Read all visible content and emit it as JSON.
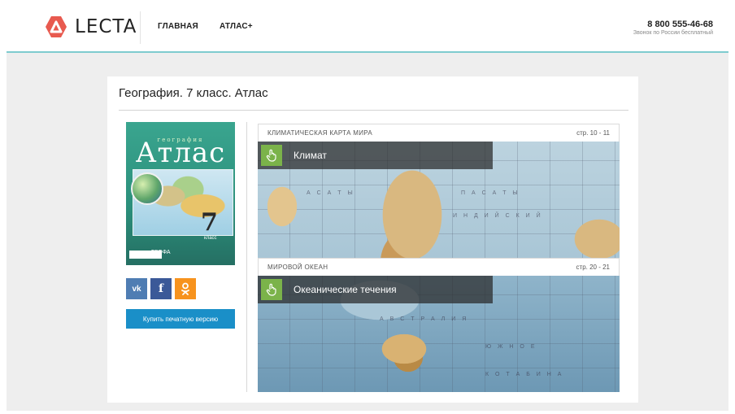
{
  "header": {
    "logo_text": "LECTA",
    "nav": [
      "ГЛАВНАЯ",
      "АТЛАС+"
    ],
    "phone": "8 800 555-46-68",
    "phone_note": "Звонок по России бесплатный"
  },
  "page": {
    "title": "География. 7 класс. Атлас"
  },
  "cover": {
    "subtitle": "география",
    "title": "Атлас",
    "grade": "7",
    "grade_word": "класс",
    "publisher": "ДРОФА"
  },
  "socials": [
    {
      "name": "vk",
      "label": "vk",
      "color": "#4f7db3"
    },
    {
      "name": "facebook",
      "label": "f",
      "color": "#3b5998"
    },
    {
      "name": "odnoklassniki",
      "label": "ok",
      "color": "#f7931e"
    }
  ],
  "buy_button": "Купить печатную версию",
  "sections": [
    {
      "name": "КЛИМАТИЧЕСКАЯ КАРТА МИРА",
      "pages": "стр. 10 - 11",
      "label": "Климат"
    },
    {
      "name": "МИРОВОЙ ОКЕАН",
      "pages": "стр. 20 - 21",
      "label": "Океанические течения"
    }
  ],
  "colors": {
    "accent_teal": "#7ecbcf",
    "logo_red": "#e85a4f",
    "button_blue": "#1a8fc8",
    "hand_green": "#7bb34a"
  }
}
